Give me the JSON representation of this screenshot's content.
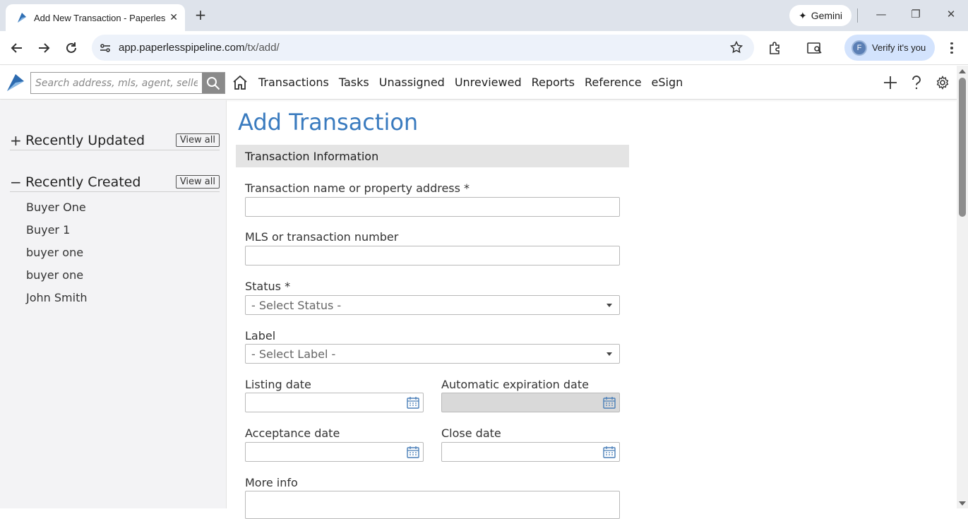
{
  "browser": {
    "tab_title": "Add New Transaction - Paperless Pipeline",
    "gemini_label": "Gemini",
    "url_domain": "app.paperlesspipeline.com",
    "url_path": "/tx/add/",
    "profile_initial": "F",
    "profile_label": "Verify it's you"
  },
  "header": {
    "search_placeholder": "Search address, mls, agent, seller, buyer...",
    "nav": [
      "Transactions",
      "Tasks",
      "Unassigned",
      "Unreviewed",
      "Reports",
      "Reference",
      "eSign"
    ]
  },
  "sidebar": {
    "recently_updated": {
      "sign": "+",
      "title": "Recently Updated",
      "view_all": "View all"
    },
    "recently_created": {
      "sign": "−",
      "title": "Recently Created",
      "view_all": "View all",
      "items": [
        "Buyer One",
        "Buyer 1",
        "buyer one",
        "buyer one",
        "John Smith"
      ]
    }
  },
  "form": {
    "page_title": "Add Transaction",
    "section_title": "Transaction Information",
    "name_label": "Transaction name or property address *",
    "name_value": "",
    "mls_label": "MLS or transaction number",
    "mls_value": "",
    "status_label": "Status *",
    "status_value": "- Select Status -",
    "label_label": "Label",
    "label_value": "- Select Label -",
    "listing_date_label": "Listing date",
    "expiration_label": "Automatic expiration date",
    "acceptance_label": "Acceptance date",
    "close_label": "Close date",
    "more_info_label": "More info"
  },
  "colors": {
    "accent": "#3a7bbf",
    "section_bg": "#e4e4e4",
    "sidebar_bg": "#f3f3f5"
  }
}
